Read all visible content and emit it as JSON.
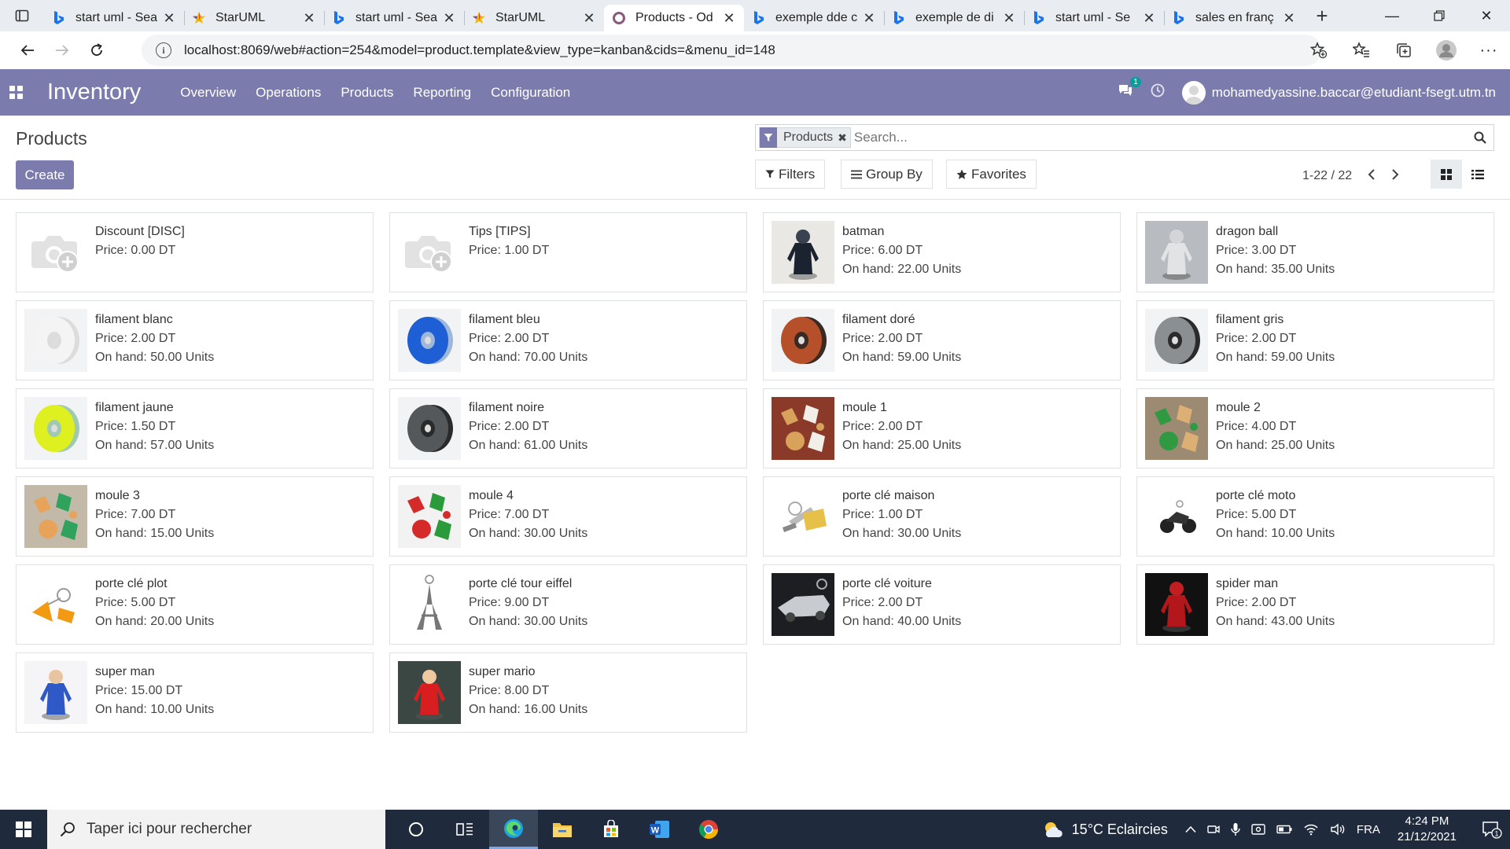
{
  "browser": {
    "tabs": [
      {
        "title": "start uml - Sea",
        "favicon": "bing",
        "active": false
      },
      {
        "title": "StarUML",
        "favicon": "staruml",
        "active": false
      },
      {
        "title": "start uml - Sea",
        "favicon": "bing",
        "active": false
      },
      {
        "title": "StarUML",
        "favicon": "staruml",
        "active": false
      },
      {
        "title": "Products - Od",
        "favicon": "odoo",
        "active": true
      },
      {
        "title": "exemple dde c",
        "favicon": "bing",
        "active": false
      },
      {
        "title": "exemple de di",
        "favicon": "bing",
        "active": false
      },
      {
        "title": "start uml - Se",
        "favicon": "bing",
        "active": false
      },
      {
        "title": "sales en franç",
        "favicon": "bing",
        "active": false
      }
    ],
    "url": "localhost:8069/web#action=254&model=product.template&view_type=kanban&cids=&menu_id=148"
  },
  "navbar": {
    "app_name": "Inventory",
    "menu": [
      "Overview",
      "Operations",
      "Products",
      "Reporting",
      "Configuration"
    ],
    "messages_badge": "1",
    "user_email": "mohamedyassine.baccar@etudiant-fsegt.utm.tn",
    "color": "#7c7bad"
  },
  "control_panel": {
    "breadcrumb": "Products",
    "create_label": "Create",
    "search_facet": "Products",
    "search_placeholder": "Search...",
    "filters_label": "Filters",
    "groupby_label": "Group By",
    "favorites_label": "Favorites",
    "pager": "1-22 / 22"
  },
  "products": [
    {
      "name": "Discount [DISC]",
      "price": "Price: 0.00 DT",
      "onhand": "",
      "image": "placeholder-camera"
    },
    {
      "name": "Tips [TIPS]",
      "price": "Price: 1.00 DT",
      "onhand": "",
      "image": "placeholder-camera"
    },
    {
      "name": "batman",
      "price": "Price: 6.00 DT",
      "onhand": "On hand: 22.00 Units",
      "image": "figurine-dark"
    },
    {
      "name": "dragon ball",
      "price": "Price: 3.00 DT",
      "onhand": "On hand: 35.00 Units",
      "image": "figurine-grey"
    },
    {
      "name": "filament blanc",
      "price": "Price: 2.00 DT",
      "onhand": "On hand: 50.00 Units",
      "image": "spool-white"
    },
    {
      "name": "filament bleu",
      "price": "Price: 2.00 DT",
      "onhand": "On hand: 70.00 Units",
      "image": "spool-blue"
    },
    {
      "name": "filament doré",
      "price": "Price: 2.00 DT",
      "onhand": "On hand: 59.00 Units",
      "image": "spool-copper"
    },
    {
      "name": "filament gris",
      "price": "Price: 2.00 DT",
      "onhand": "On hand: 59.00 Units",
      "image": "spool-grey"
    },
    {
      "name": "filament jaune",
      "price": "Price: 1.50 DT",
      "onhand": "On hand: 57.00 Units",
      "image": "spool-yellow"
    },
    {
      "name": "filament noire",
      "price": "Price: 2.00 DT",
      "onhand": "On hand: 61.00 Units",
      "image": "spool-black"
    },
    {
      "name": "moule 1",
      "price": "Price: 2.00 DT",
      "onhand": "On hand: 25.00 Units",
      "image": "mold-cookies"
    },
    {
      "name": "moule 2",
      "price": "Price: 4.00 DT",
      "onhand": "On hand: 25.00 Units",
      "image": "mold-cookies-green"
    },
    {
      "name": "moule 3",
      "price": "Price: 7.00 DT",
      "onhand": "On hand: 15.00 Units",
      "image": "mold-orange"
    },
    {
      "name": "moule 4",
      "price": "Price: 7.00 DT",
      "onhand": "On hand: 30.00 Units",
      "image": "mold-xmas"
    },
    {
      "name": "porte clé maison",
      "price": "Price: 1.00 DT",
      "onhand": "On hand: 30.00 Units",
      "image": "keychain-house"
    },
    {
      "name": "porte clé moto",
      "price": "Price: 5.00 DT",
      "onhand": "On hand: 10.00 Units",
      "image": "keychain-moto"
    },
    {
      "name": "porte clé plot",
      "price": "Price: 5.00 DT",
      "onhand": "On hand: 20.00 Units",
      "image": "keychain-cone"
    },
    {
      "name": "porte clé tour eiffel",
      "price": "Price: 9.00 DT",
      "onhand": "On hand: 30.00 Units",
      "image": "keychain-eiffel"
    },
    {
      "name": "porte clé voiture",
      "price": "Price: 2.00 DT",
      "onhand": "On hand: 40.00 Units",
      "image": "keychain-car"
    },
    {
      "name": "spider man",
      "price": "Price: 2.00 DT",
      "onhand": "On hand: 43.00 Units",
      "image": "figurine-red"
    },
    {
      "name": "super man",
      "price": "Price: 15.00 DT",
      "onhand": "On hand: 10.00 Units",
      "image": "figurine-blue"
    },
    {
      "name": "super mario",
      "price": "Price: 8.00 DT",
      "onhand": "On hand: 16.00 Units",
      "image": "figurine-mario"
    }
  ],
  "taskbar": {
    "search_placeholder": "Taper ici pour rechercher",
    "weather": "15°C Eclaircies",
    "lang": "FRA",
    "time": "4:24 PM",
    "date": "21/12/2021",
    "notif_count": "1"
  }
}
